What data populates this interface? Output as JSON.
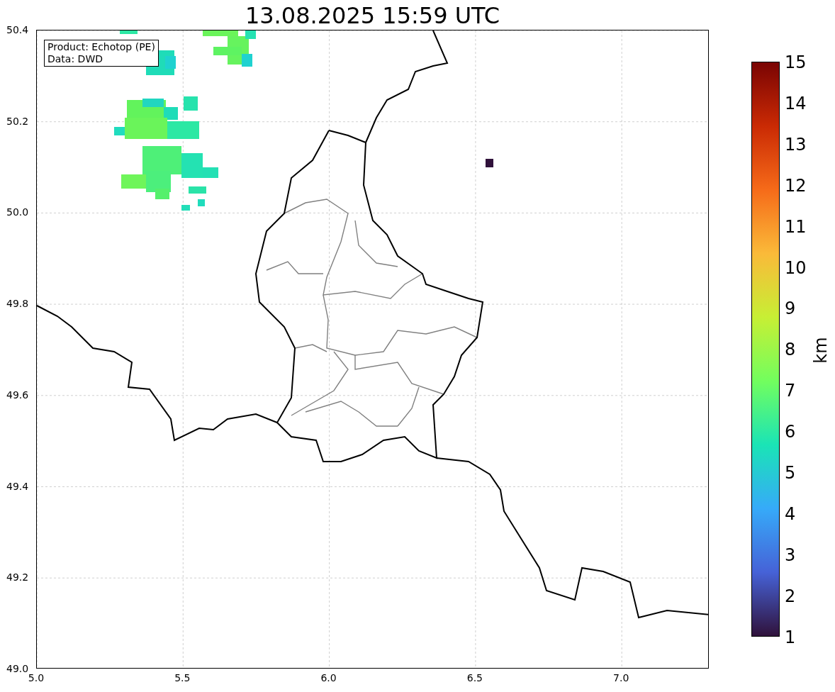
{
  "title": "13.08.2025 15:59 UTC",
  "info_box": {
    "lines": [
      "Product: Echotop (PE)",
      "Data: DWD"
    ]
  },
  "map": {
    "xticks": [
      "5.0",
      "5.5",
      "6.0",
      "6.5",
      "7.0"
    ],
    "yticks": [
      "50.4",
      "50.2",
      "50.0",
      "49.8",
      "49.6",
      "49.4",
      "49.2",
      "49.0"
    ]
  },
  "colorbar": {
    "label": "km",
    "ticks": [
      "15",
      "14",
      "13",
      "12",
      "11",
      "10",
      "9",
      "8",
      "7",
      "6",
      "5",
      "4",
      "3",
      "2",
      "1"
    ]
  }
}
